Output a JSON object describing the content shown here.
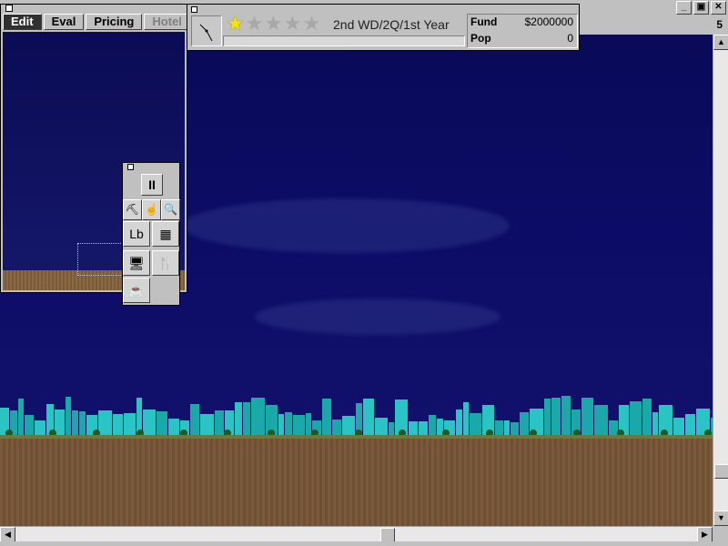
{
  "minimap": {
    "tabs": [
      {
        "label": "Edit",
        "state": "active"
      },
      {
        "label": "Eval",
        "state": "normal"
      },
      {
        "label": "Pricing",
        "state": "normal"
      },
      {
        "label": "Hotel",
        "state": "disabled"
      }
    ]
  },
  "status": {
    "star_rating": 1,
    "star_max": 5,
    "date": "2nd WD/2Q/1st Year",
    "progress_fraction": 0,
    "fund_label": "Fund",
    "fund_value": "$2000000",
    "pop_label": "Pop",
    "pop_value": "0"
  },
  "window": {
    "buttons": [
      "_",
      "▣",
      "✕"
    ],
    "speed": "5"
  },
  "palette": {
    "pause": "II",
    "tools": [
      {
        "name": "bulldozer-icon",
        "glyph": "⛏"
      },
      {
        "name": "hand-icon",
        "glyph": "☝"
      },
      {
        "name": "magnifier-icon",
        "glyph": "🔍"
      },
      {
        "name": "lobby-icon",
        "glyph": "Lb"
      },
      {
        "name": "floor-icon",
        "glyph": "▦"
      },
      {
        "name": "office-icon",
        "glyph": "🖥"
      },
      {
        "name": "restaurant-icon",
        "glyph": "🍴"
      },
      {
        "name": "condo-icon",
        "glyph": "☕"
      }
    ]
  },
  "colors": {
    "sky": "#0b0b60",
    "skyline": "#1aa8a8",
    "ground": "#7a5a3a",
    "active_tab": "#303030",
    "star_lit": "#f4e400"
  }
}
